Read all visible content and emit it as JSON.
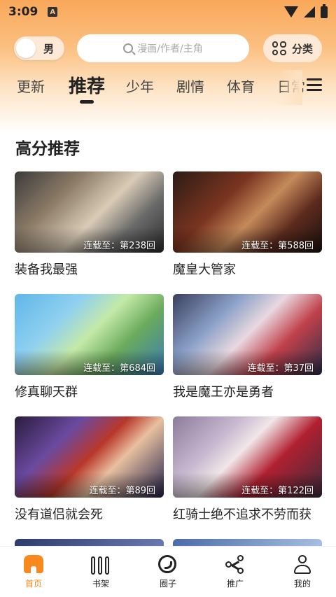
{
  "status": {
    "time": "3:09",
    "notification_icon": "A"
  },
  "header": {
    "gender_label": "男",
    "search_placeholder": "漫画/作者/主角",
    "category_label": "分类"
  },
  "tabs": [
    "更新",
    "推荐",
    "少年",
    "剧情",
    "体育",
    "日常"
  ],
  "active_tab": "推荐",
  "section": {
    "title": "高分推荐"
  },
  "cards": [
    {
      "title": "装备我最强",
      "badge": "连载至：第238回"
    },
    {
      "title": "魔皇大管家",
      "badge": "连载至：第588回"
    },
    {
      "title": "修真聊天群",
      "badge": "连载至：第684回"
    },
    {
      "title": "我是魔王亦是勇者",
      "badge": "连载至：第37回"
    },
    {
      "title": "没有道侣就会死",
      "badge": "连载至：第89回"
    },
    {
      "title": "红骑士绝不追求不劳而获",
      "badge": "连载至：第122回"
    }
  ],
  "bottom_nav": [
    {
      "label": "首页",
      "icon": "home-icon",
      "active": true
    },
    {
      "label": "书架",
      "icon": "bookshelf-icon",
      "active": false
    },
    {
      "label": "圈子",
      "icon": "community-icon",
      "active": false
    },
    {
      "label": "推广",
      "icon": "share-icon",
      "active": false
    },
    {
      "label": "我的",
      "icon": "profile-icon",
      "active": false
    }
  ],
  "colors": {
    "accent": "#f7891e",
    "header_top": "#f9a85a"
  }
}
